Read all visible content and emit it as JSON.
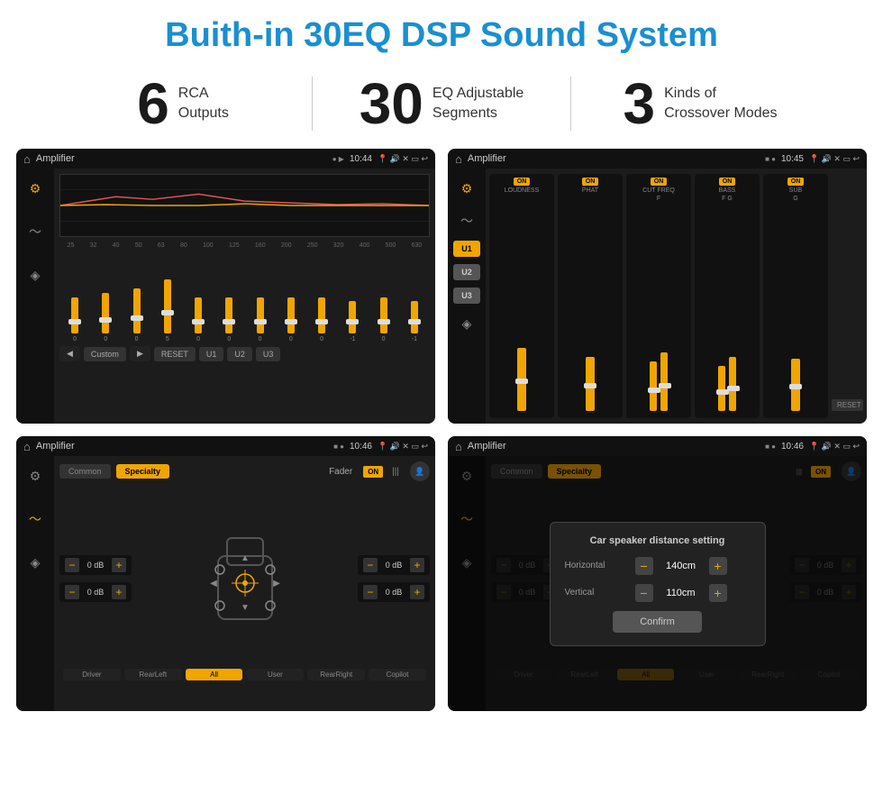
{
  "page": {
    "title": "Buith-in 30EQ DSP Sound System",
    "stats": [
      {
        "number": "6",
        "label": "RCA\nOutputs"
      },
      {
        "number": "30",
        "label": "EQ Adjustable\nSegments"
      },
      {
        "number": "3",
        "label": "Kinds of\nCrossover Modes"
      }
    ]
  },
  "screens": {
    "eq": {
      "title": "Amplifier",
      "time": "10:44",
      "frequencies": [
        "25",
        "32",
        "40",
        "50",
        "63",
        "80",
        "100",
        "125",
        "160",
        "200",
        "250",
        "320",
        "400",
        "500",
        "630"
      ],
      "values": [
        "0",
        "0",
        "0",
        "5",
        "0",
        "0",
        "0",
        "0",
        "0",
        "-1",
        "0",
        "-1"
      ],
      "preset": "Custom",
      "buttons": [
        "RESET",
        "U1",
        "U2",
        "U3"
      ]
    },
    "crossover": {
      "title": "Amplifier",
      "time": "10:45",
      "presets": [
        "U1",
        "U2",
        "U3"
      ],
      "modules": [
        {
          "label": "LOUDNESS",
          "on": true
        },
        {
          "label": "PHAT",
          "on": true
        },
        {
          "label": "CUT FREQ",
          "on": true
        },
        {
          "label": "BASS",
          "on": true
        },
        {
          "label": "SUB",
          "on": true
        }
      ],
      "resetBtn": "RESET"
    },
    "fader": {
      "title": "Amplifier",
      "time": "10:46",
      "tabs": [
        "Common",
        "Specialty"
      ],
      "activeTab": "Specialty",
      "faderLabel": "Fader",
      "faderOn": "ON",
      "leftControls": [
        {
          "value": "0 dB"
        },
        {
          "value": "0 dB"
        }
      ],
      "rightControls": [
        {
          "value": "0 dB"
        },
        {
          "value": "0 dB"
        }
      ],
      "bottomLabels": [
        "Driver",
        "RearLeft",
        "All",
        "User",
        "RearRight",
        "Copilot"
      ]
    },
    "dialog": {
      "title": "Amplifier",
      "time": "10:46",
      "tabs": [
        "Common",
        "Specialty"
      ],
      "dialogTitle": "Car speaker distance setting",
      "horizontal": {
        "label": "Horizontal",
        "value": "140cm"
      },
      "vertical": {
        "label": "Vertical",
        "value": "110cm"
      },
      "confirmBtn": "Confirm",
      "bottomLabels": [
        "Driver",
        "RearLeft",
        "All",
        "User",
        "RearRight",
        "Copilot"
      ]
    }
  }
}
